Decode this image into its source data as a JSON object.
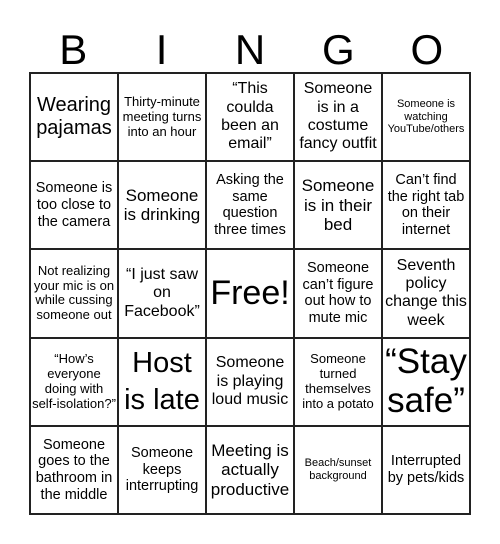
{
  "header": {
    "letters": [
      "B",
      "I",
      "N",
      "G",
      "O"
    ]
  },
  "cells": [
    "Wearing pajamas",
    "Thirty-minute meeting turns into an hour",
    "“This coulda been an email”",
    "Someone is in a costume fancy outfit",
    "Someone is watching YouTube/others",
    "Someone is too close to the camera",
    "Someone is drinking",
    "Asking the same question three times",
    "Someone is in their bed",
    "Can’t find the right tab on their internet",
    "Not realizing your mic is on while cussing someone out",
    "“I just saw on Facebook”",
    "Free!",
    "Someone can’t figure out how to mute mic",
    "Seventh policy change this week",
    "“How’s everyone doing with self-isolation?”",
    "Host is late",
    "Someone is playing loud music",
    "Someone turned themselves into a potato",
    "“Stay safe”",
    "Someone goes to the bathroom in the middle",
    "Someone keeps interrupting",
    "Meeting is actually productive",
    "Beach/sunset background",
    "Interrupted by pets/kids"
  ]
}
